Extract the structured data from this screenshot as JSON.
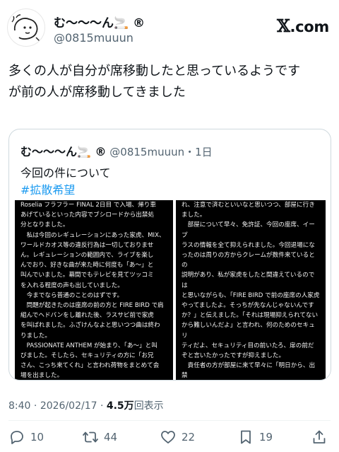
{
  "author": {
    "display_name": "む〜〜〜ん🚬 ®",
    "handle": "@0815muuun"
  },
  "brand": {
    "x": "𝕏",
    "suffix": ".com"
  },
  "tweet": {
    "line1": "多くの人が自分が席移動したと思っているようです",
    "line2": "が前の人が席移動してきました"
  },
  "quote": {
    "display_name": "む〜〜〜ん🚬 ®",
    "meta": "@0815muuun・1日",
    "text": "今回の件について",
    "hashtag": "#拡散希望",
    "left_page": [
      "Roselia フラフラー FINAL 2日目 で入場、帰り車",
      "あげているといった内容でブシロードから出禁処",
      "分となりました。",
      "　私は今回のレギュレーションにあった家虎、MIX、",
      "ワールドカオス等の違反行為は一切しておりませ",
      "ん。レギュレーションの範囲内で、ライブを楽し",
      "んでおり、好きな曲が来た時に何度も「あ〜」と",
      "叫んでいました。幕間でもテレビを見てツッコミ",
      "を入れる程度の声も出していました。",
      "　今までなら普通のことのはずです。",
      "　問題が起きたのは座席の前の方と FIRE BIRD で肩",
      "組んでヘドバンをし離れた後、ラスサビ前で家虎",
      "を叫ばれました。ふざけんなよと思いつつ曲は終わ",
      "りました。",
      "　PASSIONATE ANTHEM が始まり、「あ〜」と叫",
      "びました。そしたら、セキュリティの方に「お兄",
      "さん、こっち来てくれ」と言われ荷物をまとめて会",
      "場を出ました。"
    ],
    "right_page": [
      "れ、注意で済むといいなと思いつつ、部屋に行き",
      "ました。",
      "　部屋について早々、免許証、今回の座席、イープ",
      "ラスの情報を全て抑えられました。今回退場にな",
      "ったのは周りの方からクレームが数件来ているとの",
      "説明があり、私が家虎をしたと間違えているのでは",
      "と思いながらも、「FIRE BIRD で前の座席の人家虎",
      "やってましたよ。そっちが先なんじゃないんです",
      "か？」と伝えました。「それは現場抑えられてない",
      "から難しいんだよ」と言われ、何のためのセキュリ",
      "ティだよ、セキュリティ目の前いたろ、扉の前だ",
      "ぞと言いたかったですが抑えました。",
      "　責任者の方が部屋に来て早々に「明日から、出禁",
      "な」と言われ、セキュリティの方も驚いていまし",
      "た。すぐにセキュリティの方を外に出して会議し",
      "ていました。私自身納得もいかないため、「目の",
      "前で家虎をしていた人より声を出していた私を出",
      "禁にするのはおかしい」と伝えました。ですが、"
    ]
  },
  "meta": {
    "time": "8:40",
    "date": "2026/02/17",
    "views": "4.5万",
    "views_label": "回表示"
  },
  "actions": {
    "reply_count": "10",
    "retweet_count": "44",
    "like_count": "22",
    "bookmark_count": "19"
  },
  "colors": {
    "text": "#0f1419",
    "muted": "#536471",
    "link": "#1d9bf0",
    "border": "#cfd9de"
  }
}
